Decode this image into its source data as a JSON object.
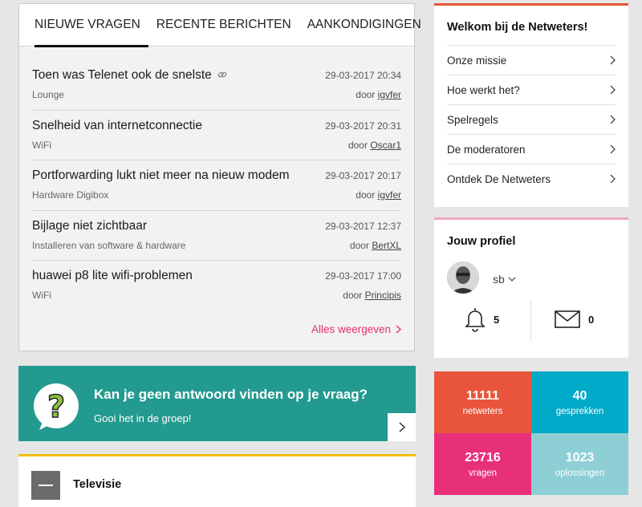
{
  "tabs": [
    {
      "label": "NIEUWE VRAGEN",
      "active": true
    },
    {
      "label": "RECENTE BERICHTEN",
      "active": false
    },
    {
      "label": "AANKONDIGINGEN",
      "active": false
    }
  ],
  "questions": [
    {
      "title": "Toen was Telenet ook de snelste",
      "has_link_icon": true,
      "category": "Lounge",
      "date": "29-03-2017 20:34",
      "by": "door",
      "author": "igvfer"
    },
    {
      "title": "Snelheid van internetconnectie",
      "has_link_icon": false,
      "category": "WiFi",
      "date": "29-03-2017 20:31",
      "by": "door",
      "author": "Oscar1"
    },
    {
      "title": "Portforwarding lukt niet meer na nieuw modem",
      "has_link_icon": false,
      "category": "Hardware Digibox",
      "date": "29-03-2017 20:17",
      "by": "door",
      "author": "igvfer"
    },
    {
      "title": "Bijlage niet zichtbaar",
      "has_link_icon": false,
      "category": "Installeren van software & hardware",
      "date": "29-03-2017 12:37",
      "by": "door",
      "author": "BertXL"
    },
    {
      "title": "huawei p8 lite wifi-problemen",
      "has_link_icon": false,
      "category": "WiFi",
      "date": "29-03-2017 17:00",
      "by": "door",
      "author": "Principis"
    }
  ],
  "show_all": "Alles weergeven",
  "promo": {
    "title": "Kan je geen antwoord vinden op je vraag?",
    "subtitle": "Gooi het in de groep!",
    "color": "#239a8f"
  },
  "category_section": {
    "title": "Televisie",
    "accent": "#f5c000"
  },
  "welcome": {
    "title": "Welkom bij de Netweters!",
    "items": [
      "Onze missie",
      "Hoe werkt het?",
      "Spelregels",
      "De moderatoren",
      "Ontdek De Netweters"
    ]
  },
  "profile": {
    "title": "Jouw profiel",
    "username": "sb",
    "notifications": "5",
    "messages": "0"
  },
  "stats": [
    {
      "value": "11111",
      "label": "netweters",
      "color": "#e8553b"
    },
    {
      "value": "40",
      "label": "gesprekken",
      "color": "#00aac8"
    },
    {
      "value": "23716",
      "label": "vragen",
      "color": "#e8307a"
    },
    {
      "value": "1023",
      "label": "oplossingen",
      "color": "#8ecfd6"
    }
  ]
}
